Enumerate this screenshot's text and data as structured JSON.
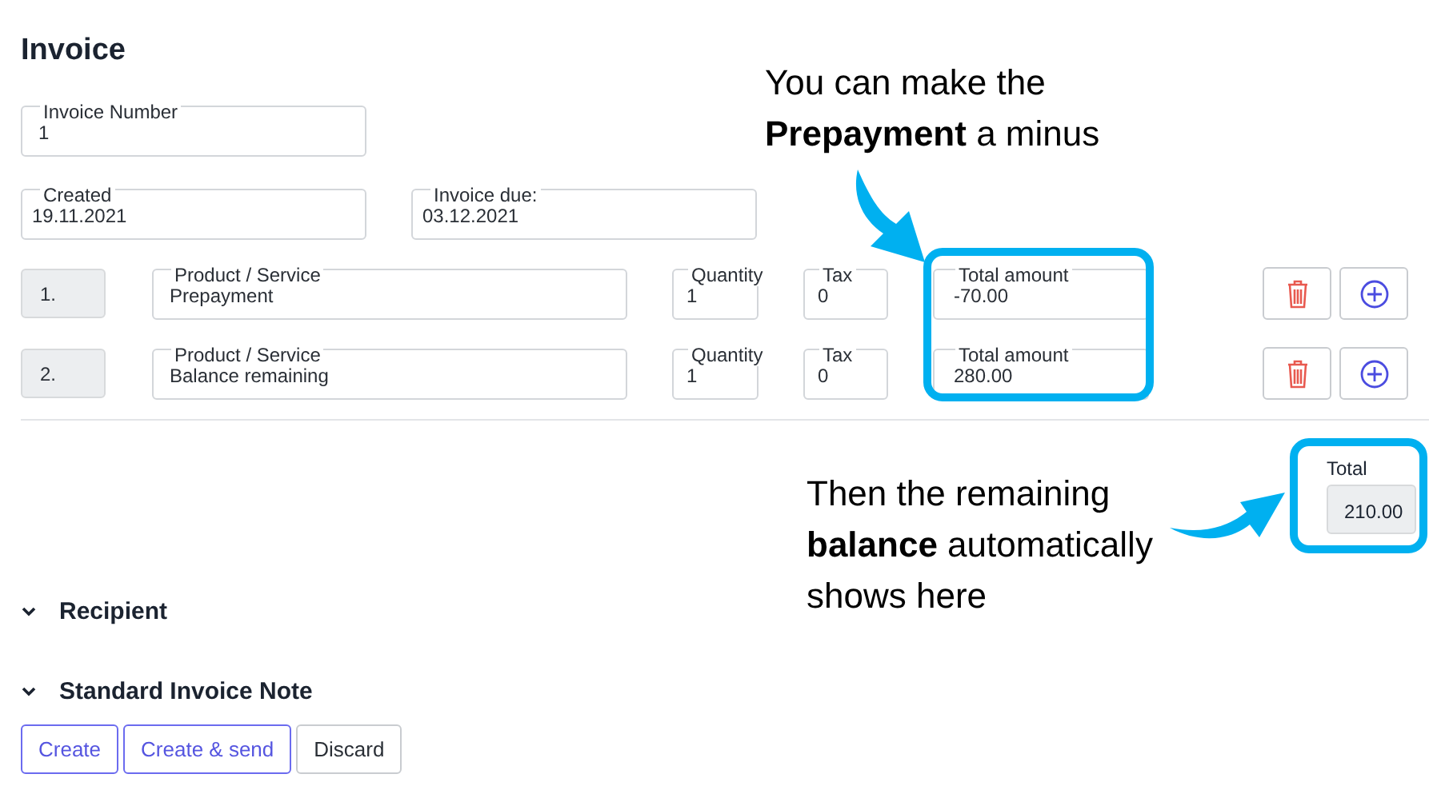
{
  "title": "Invoice",
  "invoice_number": {
    "label": "Invoice Number",
    "value": "1"
  },
  "dates": [
    {
      "label": "Created",
      "value": "19.11.2021"
    },
    {
      "label": "Invoice due:",
      "value": "03.12.2021"
    }
  ],
  "line_items": [
    {
      "number": "1.",
      "product_label": "Product / Service",
      "product": "Prepayment",
      "quantity_label": "Quantity",
      "quantity": "1",
      "tax_label": "Tax",
      "tax": "0",
      "total_label": "Total amount",
      "total": "-70.00"
    },
    {
      "number": "2.",
      "product_label": "Product / Service",
      "product": "Balance remaining",
      "quantity_label": "Quantity",
      "quantity": "1",
      "tax_label": "Tax",
      "tax": "0",
      "total_label": "Total amount",
      "total": "280.00"
    }
  ],
  "total": {
    "label": "Total",
    "value": "210.00"
  },
  "sections": [
    {
      "title": "Recipient"
    },
    {
      "title": "Standard Invoice Note"
    }
  ],
  "buttons": [
    {
      "label": "Create",
      "kind": "primary"
    },
    {
      "label": "Create & send",
      "kind": "primary"
    },
    {
      "label": "Discard",
      "kind": "secondary"
    }
  ],
  "annotations": [
    {
      "lines": [
        "You can make the",
        "**Prepayment** a minus"
      ]
    },
    {
      "lines": [
        "Then the remaining",
        "**balance** automatically",
        "shows here"
      ]
    }
  ]
}
